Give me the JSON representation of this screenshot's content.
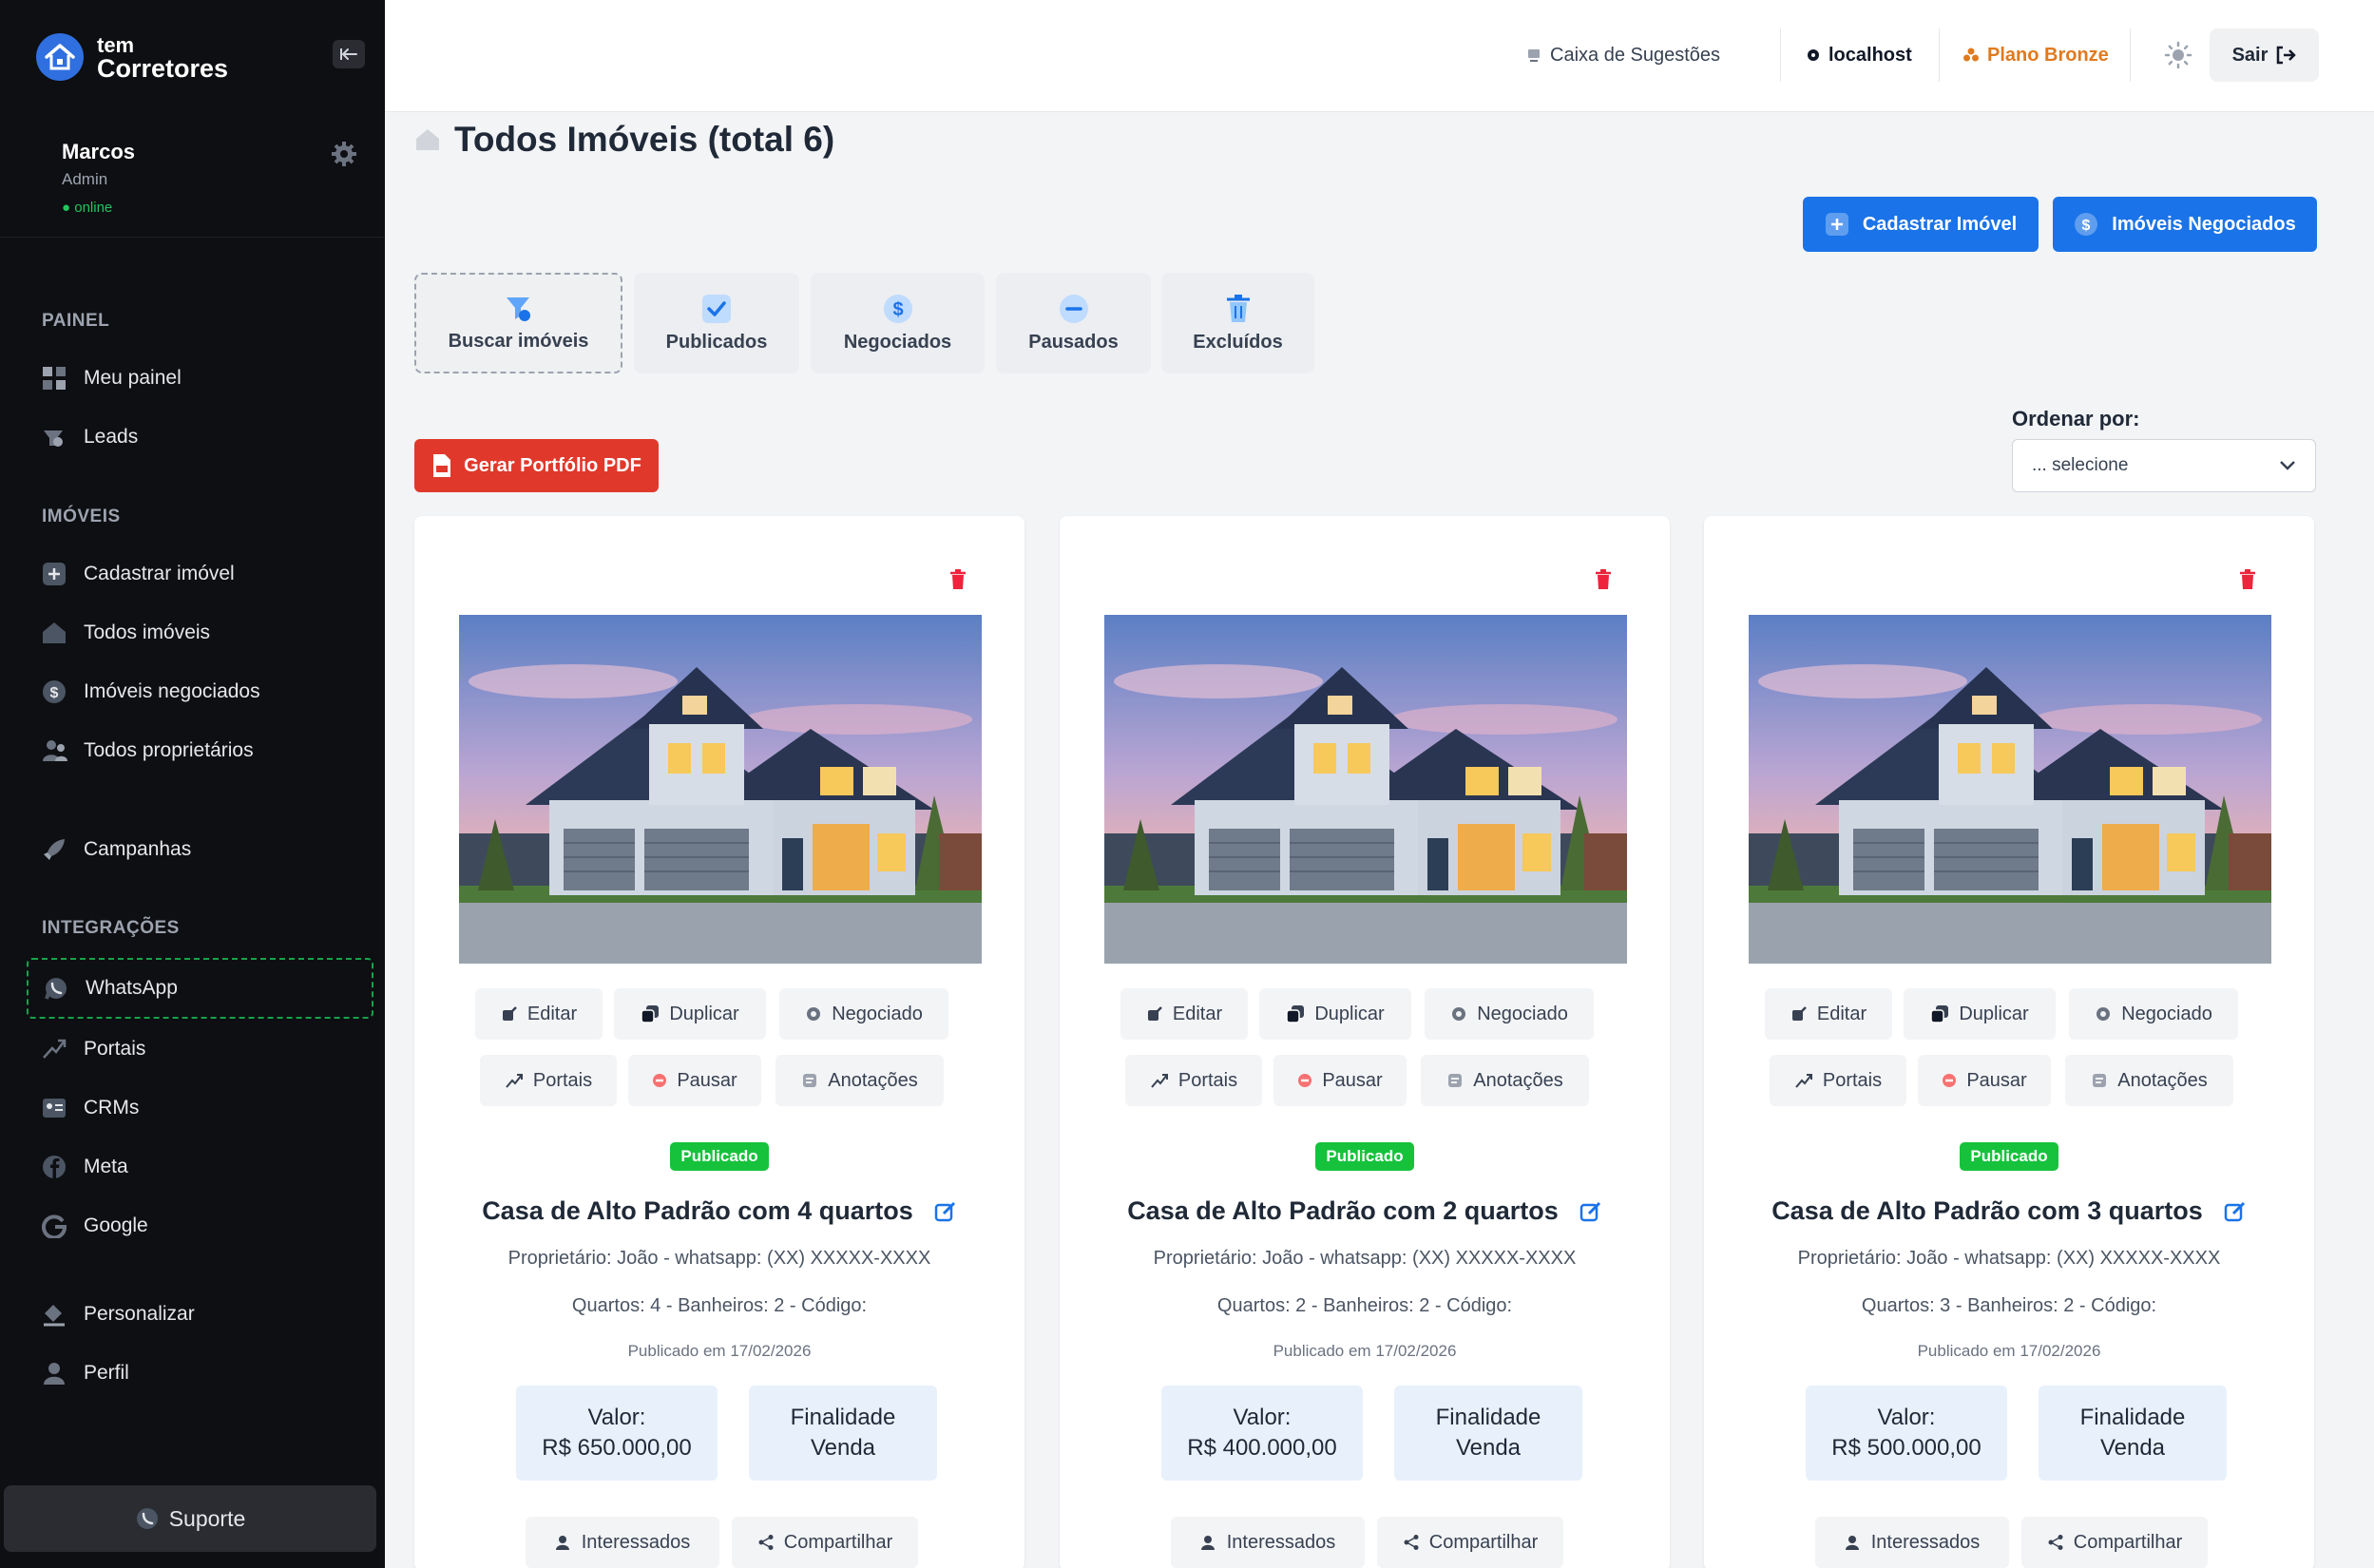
{
  "brand": {
    "line1": "tem",
    "line2": "Corretores"
  },
  "user": {
    "name": "Marcos",
    "role": "Admin",
    "status": "● online"
  },
  "sidebar": {
    "sections": {
      "painel": "PAINEL",
      "imoveis": "IMÓVEIS",
      "integracoes": "INTEGRAÇÕES"
    },
    "items": [
      {
        "label": "Meu painel",
        "icon": "grid-icon"
      },
      {
        "label": "Leads",
        "icon": "leads-icon"
      },
      {
        "label": "Cadastrar imóvel",
        "icon": "plus-square-icon"
      },
      {
        "label": "Todos imóveis",
        "icon": "home-icon"
      },
      {
        "label": "Imóveis negociados",
        "icon": "dollar-circle-icon"
      },
      {
        "label": "Todos proprietários",
        "icon": "users-icon"
      },
      {
        "label": "Campanhas",
        "icon": "rocket-icon"
      },
      {
        "label": "WhatsApp",
        "icon": "whatsapp-icon"
      },
      {
        "label": "Portais",
        "icon": "share-icon"
      },
      {
        "label": "CRMs",
        "icon": "id-card-icon"
      },
      {
        "label": "Meta",
        "icon": "facebook-icon"
      },
      {
        "label": "Google",
        "icon": "google-icon"
      },
      {
        "label": "Personalizar",
        "icon": "paint-bucket-icon"
      },
      {
        "label": "Perfil",
        "icon": "user-icon"
      }
    ],
    "support": "Suporte"
  },
  "topbar": {
    "suggestions": "Caixa de Sugestões",
    "host": "localhost",
    "plan": "Plano Bronze",
    "logout": "Sair"
  },
  "page": {
    "title": "Todos Imóveis (total 6)",
    "btn_cadastrar": "Cadastrar Imóvel",
    "btn_negociados": "Imóveis Negociados",
    "btn_pdf": "Gerar Portfólio PDF",
    "order_label": "Ordenar por:",
    "order_value": "... selecione"
  },
  "filters": [
    "Buscar imóveis",
    "Publicados",
    "Negociados",
    "Pausados",
    "Excluídos"
  ],
  "actions": {
    "edit": "Editar",
    "duplicate": "Duplicar",
    "negotiated": "Negociado",
    "portals": "Portais",
    "pause": "Pausar",
    "notes": "Anotações",
    "interested": "Interessados",
    "share": "Compartilhar"
  },
  "colors": {
    "primary": "#1a73e8",
    "danger": "#e0392b",
    "success": "#16c23c",
    "plan": "#e07a1f",
    "sidebar": "#0e0f12"
  },
  "cards": [
    {
      "status": "Publicado",
      "title": "Casa de Alto Padrão com 4 quartos",
      "owner": "Proprietário: João - whatsapp: (XX) XXXXX-XXXX",
      "rooms": "Quartos: 4 - Banheiros: 2 - Código:",
      "published": "Publicado em 17/02/2026",
      "value_label": "Valor:",
      "value": "R$ 650.000,00",
      "purpose_label": "Finalidade",
      "purpose": "Venda"
    },
    {
      "status": "Publicado",
      "title": "Casa de Alto Padrão com 2 quartos",
      "owner": "Proprietário: João - whatsapp: (XX) XXXXX-XXXX",
      "rooms": "Quartos: 2 - Banheiros: 2 - Código:",
      "published": "Publicado em 17/02/2026",
      "value_label": "Valor:",
      "value": "R$ 400.000,00",
      "purpose_label": "Finalidade",
      "purpose": "Venda"
    },
    {
      "status": "Publicado",
      "title": "Casa de Alto Padrão com 3 quartos",
      "owner": "Proprietário: João - whatsapp: (XX) XXXXX-XXXX",
      "rooms": "Quartos: 3 - Banheiros: 2 - Código:",
      "published": "Publicado em 17/02/2026",
      "value_label": "Valor:",
      "value": "R$ 500.000,00",
      "purpose_label": "Finalidade",
      "purpose": "Venda"
    }
  ]
}
